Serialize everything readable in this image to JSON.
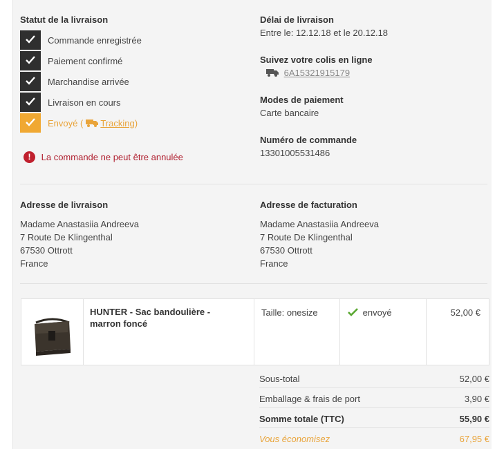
{
  "status": {
    "title": "Statut de la livraison",
    "steps": [
      {
        "label": "Commande enregistrée"
      },
      {
        "label": "Paiement confirmé"
      },
      {
        "label": "Marchandise arrivée"
      },
      {
        "label": "Livraison en cours"
      },
      {
        "label": "Envoyé (",
        "link": "Tracking",
        "suffix": ")"
      }
    ],
    "warning": "La commande ne peut être annulée"
  },
  "delivery_time": {
    "title": "Délai de livraison",
    "value": "Entre le: 12.12.18 et le 20.12.18"
  },
  "tracking": {
    "title": "Suivez votre colis en ligne",
    "number": "6A15321915179"
  },
  "payment": {
    "title": "Modes de paiement",
    "value": "Carte bancaire"
  },
  "order": {
    "title": "Numéro de commande",
    "value": "13301005531486"
  },
  "shipping_address": {
    "title": "Adresse de livraison",
    "lines": [
      "Madame Anastasiia Andreeva",
      "7 Route De Klingenthal",
      "67530 Ottrott",
      "France"
    ]
  },
  "billing_address": {
    "title": "Adresse de facturation",
    "lines": [
      "Madame Anastasiia Andreeva",
      "7 Route De Klingenthal",
      "67530 Ottrott",
      "France"
    ]
  },
  "product": {
    "name_line1": "HUNTER - Sac bandoulière -",
    "name_line2": "marron foncé",
    "size": "Taille: onesize",
    "status": "envoyé",
    "price": "52,00 €"
  },
  "totals": {
    "subtotal_label": "Sous-total",
    "subtotal_value": "52,00 €",
    "shipping_label": "Emballage & frais de port",
    "shipping_value": "3,90 €",
    "total_label": "Somme totale (TTC)",
    "total_value": "55,90 €",
    "savings_label": "Vous économisez",
    "savings_value": "67,95 €"
  },
  "colors": {
    "accent": "#f0a832",
    "dark_step": "#2f2f2f",
    "error": "#c0202e",
    "success": "#5aa832"
  }
}
